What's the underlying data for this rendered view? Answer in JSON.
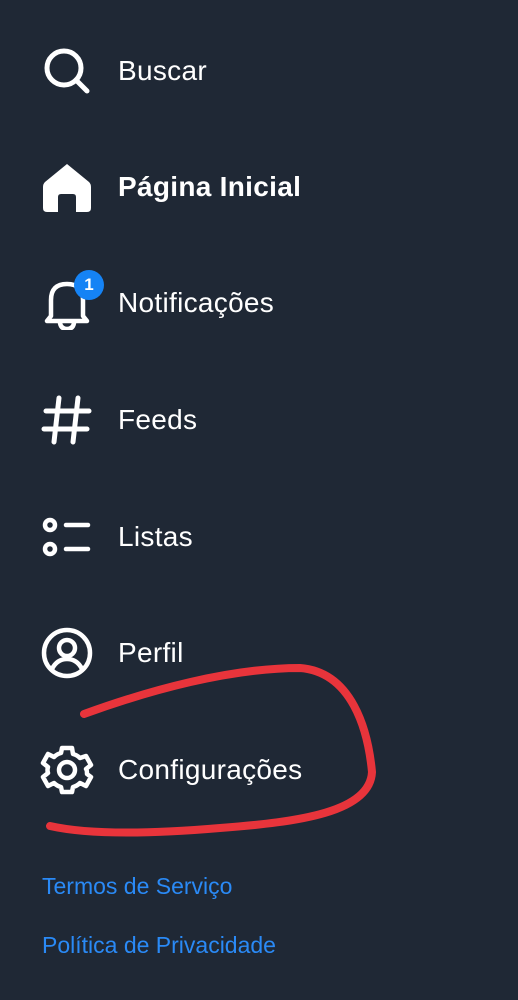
{
  "nav": {
    "items": [
      {
        "label": "Buscar",
        "icon": "search-icon"
      },
      {
        "label": "Página Inicial",
        "icon": "home-icon",
        "active": true
      },
      {
        "label": "Notificações",
        "icon": "bell-icon",
        "badge": "1"
      },
      {
        "label": "Feeds",
        "icon": "hash-icon"
      },
      {
        "label": "Listas",
        "icon": "list-icon"
      },
      {
        "label": "Perfil",
        "icon": "user-circle-icon"
      },
      {
        "label": "Configurações",
        "icon": "gear-icon"
      }
    ]
  },
  "footer": {
    "terms": "Termos de Serviço",
    "privacy": "Política de Privacidade"
  },
  "colors": {
    "background": "#1f2835",
    "text": "#ffffff",
    "link": "#2a8af6",
    "badge": "#1583f5",
    "annotation": "#e8343b"
  }
}
